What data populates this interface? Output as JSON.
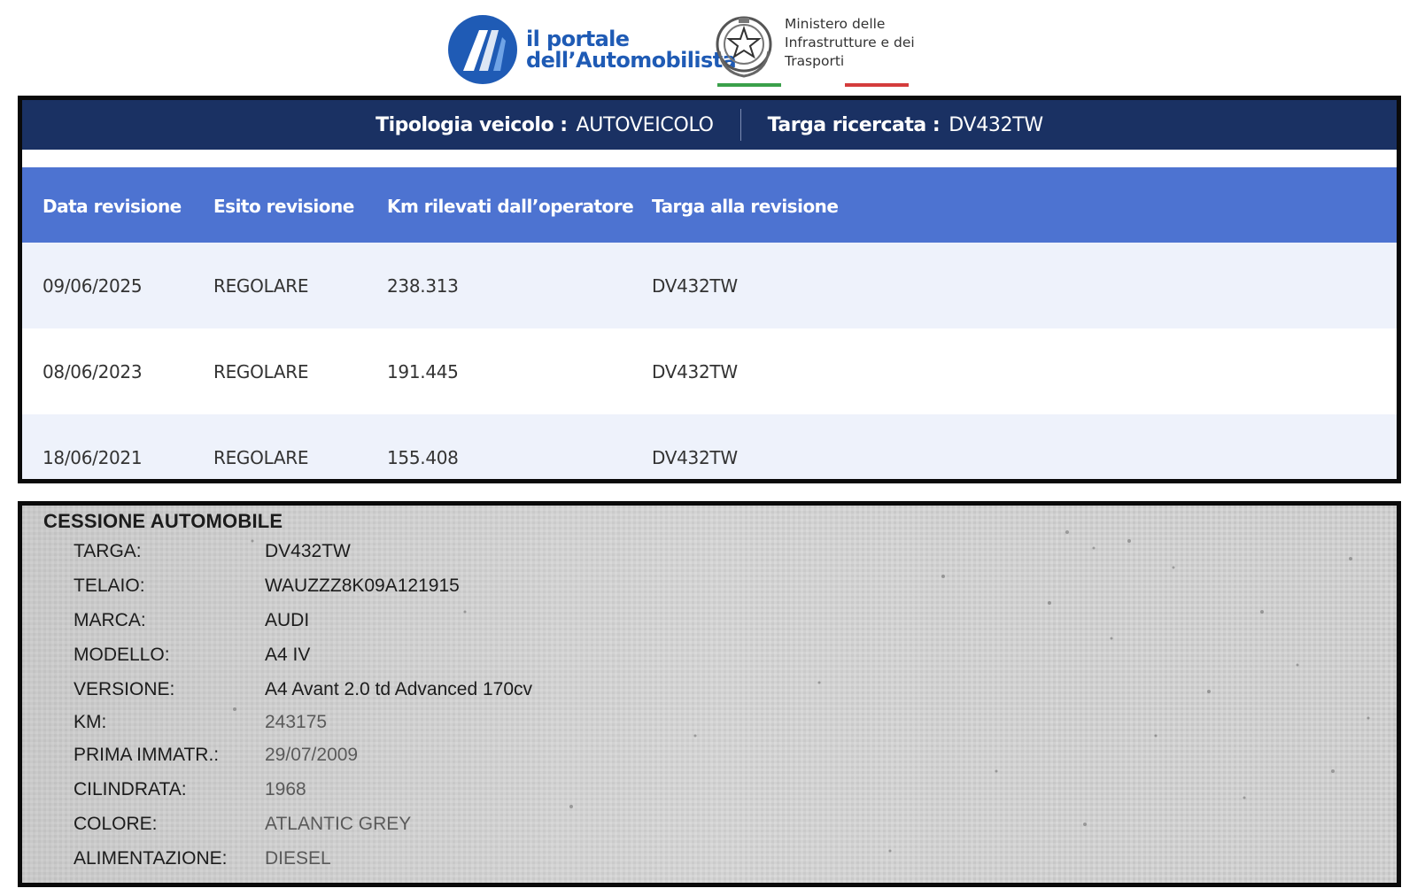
{
  "header": {
    "portale_logo_line1": "il portale",
    "portale_logo_line2": "dell’Automobilista",
    "ministry_line1": "Ministero delle",
    "ministry_line2": "Infrastrutture e dei",
    "ministry_line3": "Trasporti"
  },
  "info_bar": {
    "tipologia_label": "Tipologia veicolo :",
    "tipologia_value": "AUTOVEICOLO",
    "targa_label": "Targa ricercata :",
    "targa_value": "DV432TW"
  },
  "table": {
    "headers": [
      "Data revisione",
      "Esito revisione",
      "Km rilevati dall’operatore",
      "Targa alla revisione"
    ],
    "rows": [
      [
        "09/06/2025",
        "REGOLARE",
        "238.313",
        "DV432TW"
      ],
      [
        "08/06/2023",
        "REGOLARE",
        "191.445",
        "DV432TW"
      ],
      [
        "18/06/2021",
        "REGOLARE",
        "155.408",
        "DV432TW"
      ]
    ]
  },
  "document": {
    "title": "CESSIONE AUTOMOBILE",
    "fields": [
      {
        "label": "TARGA:",
        "value": "DV432TW"
      },
      {
        "label": "TELAIO:",
        "value": "WAUZZZ8K09A121915"
      },
      {
        "label": "MARCA:",
        "value": "AUDI"
      },
      {
        "label": "MODELLO:",
        "value": "A4 IV"
      },
      {
        "label": "VERSIONE:",
        "value": "A4 Avant 2.0 td Advanced 170cv"
      },
      {
        "label": "KM:",
        "value": "243175"
      },
      {
        "label": "PRIMA IMMATR.:",
        "value": "29/07/2009"
      },
      {
        "label": "CILINDRATA:",
        "value": "1968"
      },
      {
        "label": "COLORE:",
        "value": "ATLANTIC GREY"
      },
      {
        "label": "ALIMENTAZIONE:",
        "value": "DIESEL"
      }
    ]
  },
  "colors": {
    "info_bar_bg": "#1a3163",
    "table_header_bg": "#4d73d1",
    "row_alt_bg": "#eef2fb",
    "brand_blue": "#1f5bb5",
    "stripe_green": "#3aa04a",
    "stripe_red": "#d43c3c"
  },
  "icons": {
    "portale_logo": "road-logo-icon",
    "ministry_emblem": "italian-republic-emblem-icon"
  }
}
